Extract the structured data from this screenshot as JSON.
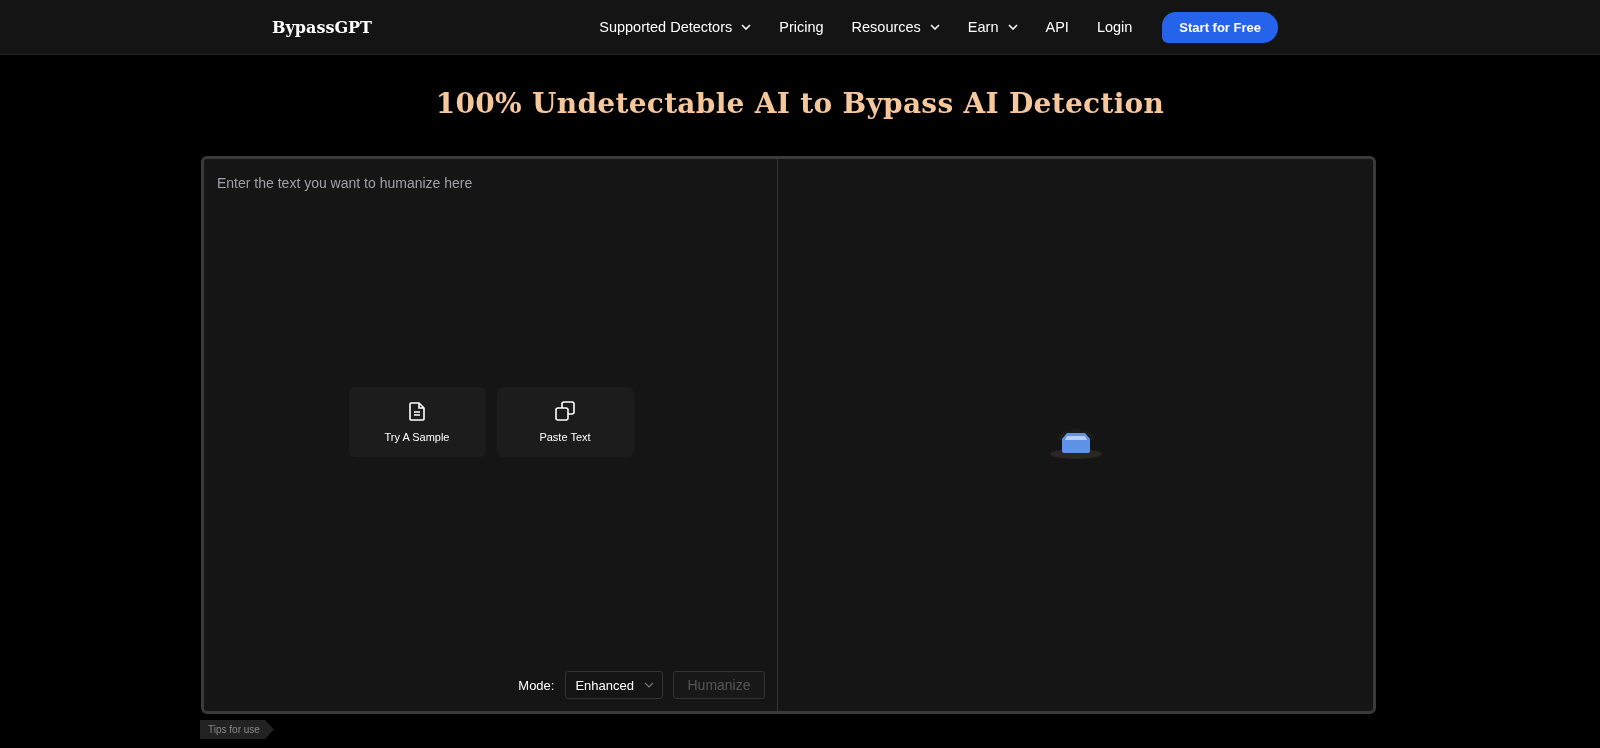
{
  "header": {
    "logo": "BypassGPT",
    "nav": [
      {
        "label": "Supported Detectors",
        "dropdown": true
      },
      {
        "label": "Pricing",
        "dropdown": false
      },
      {
        "label": "Resources",
        "dropdown": true
      },
      {
        "label": "Earn",
        "dropdown": true
      },
      {
        "label": "API",
        "dropdown": false
      },
      {
        "label": "Login",
        "dropdown": false
      }
    ],
    "cta": "Start for Free"
  },
  "title": "100% Undetectable AI to Bypass AI Detection",
  "editor": {
    "placeholder": "Enter the text you want to humanize here",
    "actions": [
      {
        "kind": "sample",
        "label": "Try A Sample"
      },
      {
        "kind": "paste",
        "label": "Paste Text"
      }
    ],
    "mode_label": "Mode:",
    "mode_value": "Enhanced",
    "submit": {
      "label": "Humanize",
      "disabled": true
    }
  },
  "tips": "Tips for use"
}
